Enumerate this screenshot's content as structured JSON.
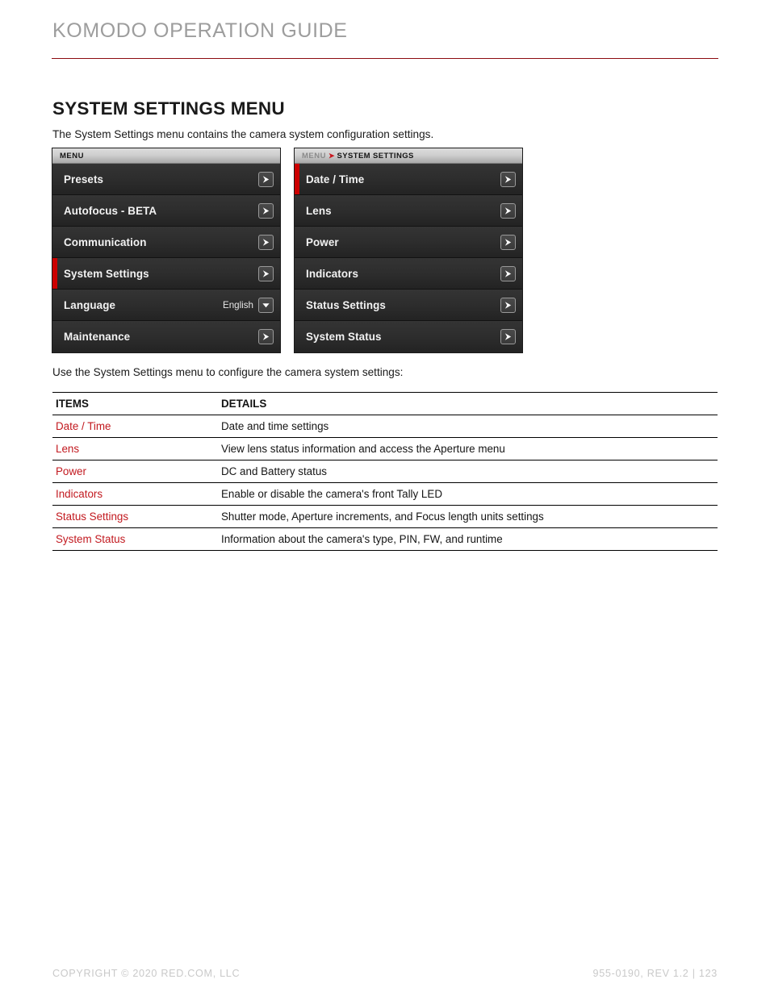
{
  "header": {
    "title": "KOMODO OPERATION GUIDE",
    "rule_color": "#8c0b10"
  },
  "section": {
    "title": "SYSTEM SETTINGS MENU",
    "intro": "The System Settings menu contains the camera system configuration settings."
  },
  "menus": {
    "left_panel": {
      "titlebar": {
        "root": "MENU"
      },
      "rows": [
        {
          "label": "Presets",
          "value": "",
          "control": "arrow-right-icon",
          "selected": false
        },
        {
          "label": "Autofocus - BETA",
          "value": "",
          "control": "arrow-right-icon",
          "selected": false
        },
        {
          "label": "Communication",
          "value": "",
          "control": "arrow-right-icon",
          "selected": false
        },
        {
          "label": "System Settings",
          "value": "",
          "control": "arrow-right-icon",
          "selected": true
        },
        {
          "label": "Language",
          "value": "English",
          "control": "chevron-down-icon",
          "selected": false
        },
        {
          "label": "Maintenance",
          "value": "",
          "control": "arrow-right-icon",
          "selected": false
        }
      ]
    },
    "right_panel": {
      "titlebar": {
        "root": "MENU",
        "separator": "➤",
        "leaf": "SYSTEM SETTINGS"
      },
      "rows": [
        {
          "label": "Date / Time",
          "value": "",
          "control": "arrow-right-icon",
          "selected": true
        },
        {
          "label": "Lens",
          "value": "",
          "control": "arrow-right-icon",
          "selected": false
        },
        {
          "label": "Power",
          "value": "",
          "control": "arrow-right-icon",
          "selected": false
        },
        {
          "label": "Indicators",
          "value": "",
          "control": "arrow-right-icon",
          "selected": false
        },
        {
          "label": "Status Settings",
          "value": "",
          "control": "arrow-right-icon",
          "selected": false
        },
        {
          "label": "System Status",
          "value": "",
          "control": "arrow-right-icon",
          "selected": false
        }
      ]
    },
    "selection_color": "#cc0000"
  },
  "table": {
    "intro": "Use the System Settings menu to configure the camera system settings:",
    "headers": [
      "ITEMS",
      "DETAILS"
    ],
    "item_color": "#c2191f",
    "rows": [
      {
        "item": "Date / Time",
        "detail": "Date and time settings"
      },
      {
        "item": "Lens",
        "detail": "View lens status information and access the Aperture menu"
      },
      {
        "item": "Power",
        "detail": "DC and Battery status"
      },
      {
        "item": "Indicators",
        "detail": "Enable or disable the camera's front Tally LED"
      },
      {
        "item": "Status Settings",
        "detail": "Shutter mode, Aperture increments, and Focus length units settings"
      },
      {
        "item": "System Status",
        "detail": "Information about the camera's type, PIN, FW, and runtime"
      }
    ]
  },
  "footer": {
    "copyright": "COPYRIGHT © 2020 RED.COM, LLC",
    "meta": "955-0190, REV 1.2  |  123"
  }
}
